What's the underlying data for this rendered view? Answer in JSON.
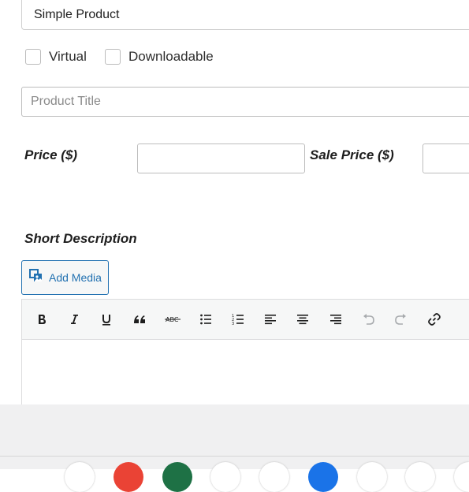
{
  "product_type": {
    "selected": "Simple Product"
  },
  "options": [
    {
      "label": "Virtual",
      "checked": false
    },
    {
      "label": "Downloadable",
      "checked": false
    }
  ],
  "title_field": {
    "placeholder": "Product Title",
    "value": ""
  },
  "pricing": {
    "price_label": "Price ($)",
    "price_value": "",
    "sale_label": "Sale Price ($)",
    "sale_value": ""
  },
  "short_description": {
    "label": "Short Description",
    "add_media_label": "Add Media"
  },
  "toolbar": [
    "bold-icon",
    "italic-icon",
    "underline-icon",
    "blockquote-icon",
    "strikethrough-icon",
    "bullet-list-icon",
    "numbered-list-icon",
    "align-left-icon",
    "align-center-icon",
    "align-right-icon",
    "undo-icon",
    "redo-icon",
    "link-icon"
  ],
  "colors": {
    "accent": "#2271b1",
    "border": "#bdbdbd",
    "footer": "#f0f0f1"
  },
  "dock_icons": [
    "white",
    "#ea4335",
    "#1e7145",
    "white",
    "white",
    "#1a73e8",
    "white",
    "white",
    "white"
  ]
}
